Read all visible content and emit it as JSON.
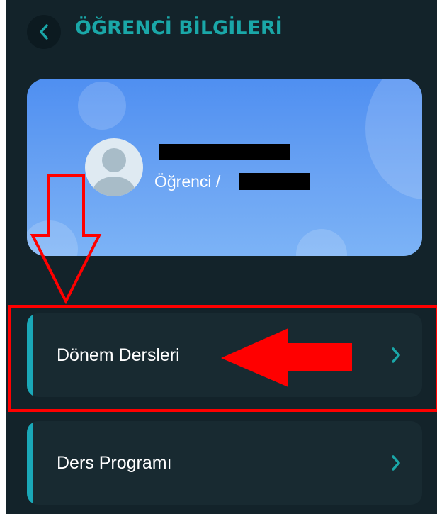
{
  "header": {
    "title": "ÖĞRENCİ BİLGİLERİ",
    "back_icon": "chevron-left-icon"
  },
  "profile": {
    "name": "█████████",
    "role_prefix": "Öğrenci /",
    "role_suffix": "███████",
    "avatar_icon": "user-avatar-icon"
  },
  "menu": {
    "items": [
      {
        "label": "Dönem Dersleri",
        "icon": "chevron-right-icon"
      },
      {
        "label": "Ders Programı",
        "icon": "chevron-right-icon"
      }
    ]
  },
  "annotations": {
    "highlight_color": "#ff0000",
    "arrow_down_icon": "arrow-down-outline-icon",
    "arrow_left_icon": "arrow-left-filled-icon"
  },
  "colors": {
    "background": "#13232a",
    "accent": "#1aa7a8",
    "card_blue": "#5b9af2",
    "menu_item_bg": "#182a31"
  }
}
